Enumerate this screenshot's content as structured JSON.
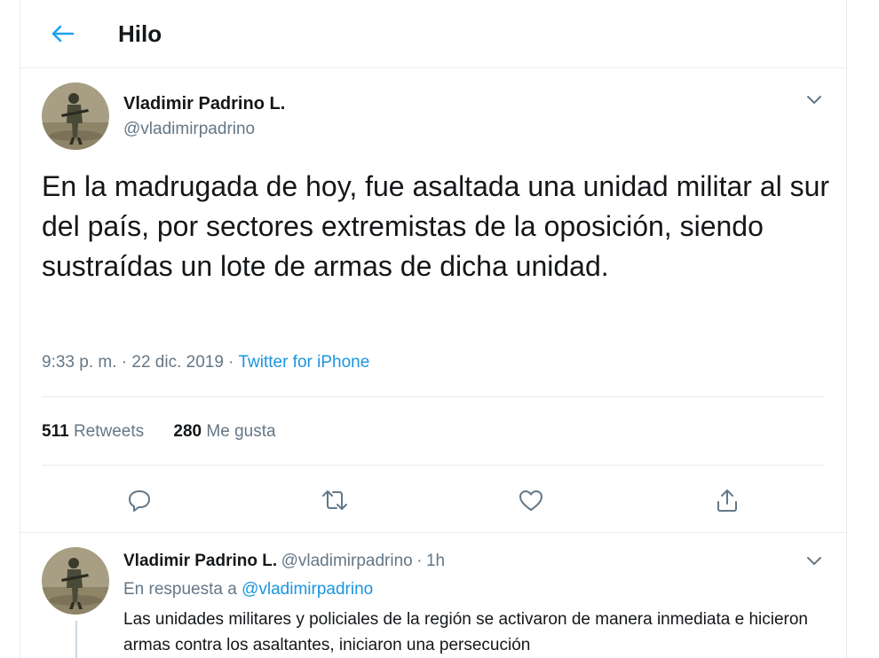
{
  "header": {
    "title": "Hilo",
    "back_icon": "arrow-left-icon"
  },
  "main_tweet": {
    "author_name": "Vladimir Padrino L.",
    "author_handle": "@vladimirpadrino",
    "text": "En la madrugada de hoy, fue asaltada una unidad militar al sur del país, por sectores extremistas de la oposición, siendo sustraídas un lote de armas de dicha unidad.",
    "time": "9:33 p. m. · 22 dic. 2019 · ",
    "source": "Twitter for iPhone",
    "retweets_count": "511",
    "retweets_label": "Retweets",
    "likes_count": "280",
    "likes_label": "Me gusta",
    "actions": [
      "reply-icon",
      "retweet-icon",
      "like-icon",
      "share-icon"
    ]
  },
  "reply_tweet": {
    "author_name": "Vladimir Padrino L.",
    "author_handle": "@vladimirpadrino",
    "separator": "·",
    "time_ago": "1h",
    "reply_prefix": "En respuesta a",
    "reply_mention": "@vladimirpadrino",
    "text": "Las unidades militares y policiales de la región se activaron de manera inmediata e hicieron armas contra los asaltantes, iniciaron una persecución"
  },
  "colors": {
    "accent": "#1da1f2",
    "link": "#1b95e0",
    "muted": "#657786",
    "text": "#14171a",
    "border": "#e6ecf0"
  }
}
